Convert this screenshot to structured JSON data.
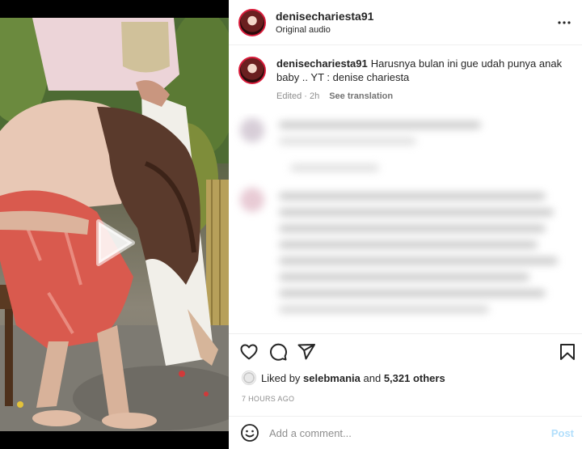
{
  "header": {
    "username": "denisechariesta91",
    "subtitle": "Original audio",
    "more_icon": "more-horizontal-icon"
  },
  "caption": {
    "username": "denisechariesta91",
    "text": "Harusnya bulan ini gue udah punya anak baby .. YT : denise chariesta",
    "edited": "Edited · 2h",
    "see_translation": "See translation"
  },
  "media": {
    "type": "video",
    "play_icon": "play-icon"
  },
  "actions": {
    "like_icon": "heart-icon",
    "comment_icon": "comment-icon",
    "share_icon": "send-icon",
    "save_icon": "bookmark-icon"
  },
  "likes": {
    "prefix": "Liked by",
    "user": "selebmania",
    "connector": "and",
    "count": "5,321 others"
  },
  "timestamp": "7 HOURS AGO",
  "comment_box": {
    "placeholder": "Add a comment...",
    "post_label": "Post",
    "emoji_icon": "emoji-icon"
  },
  "colors": {
    "accent": "#0095f6",
    "post_disabled": "#b2dffc",
    "avatar_ring": "#d81b3a"
  }
}
